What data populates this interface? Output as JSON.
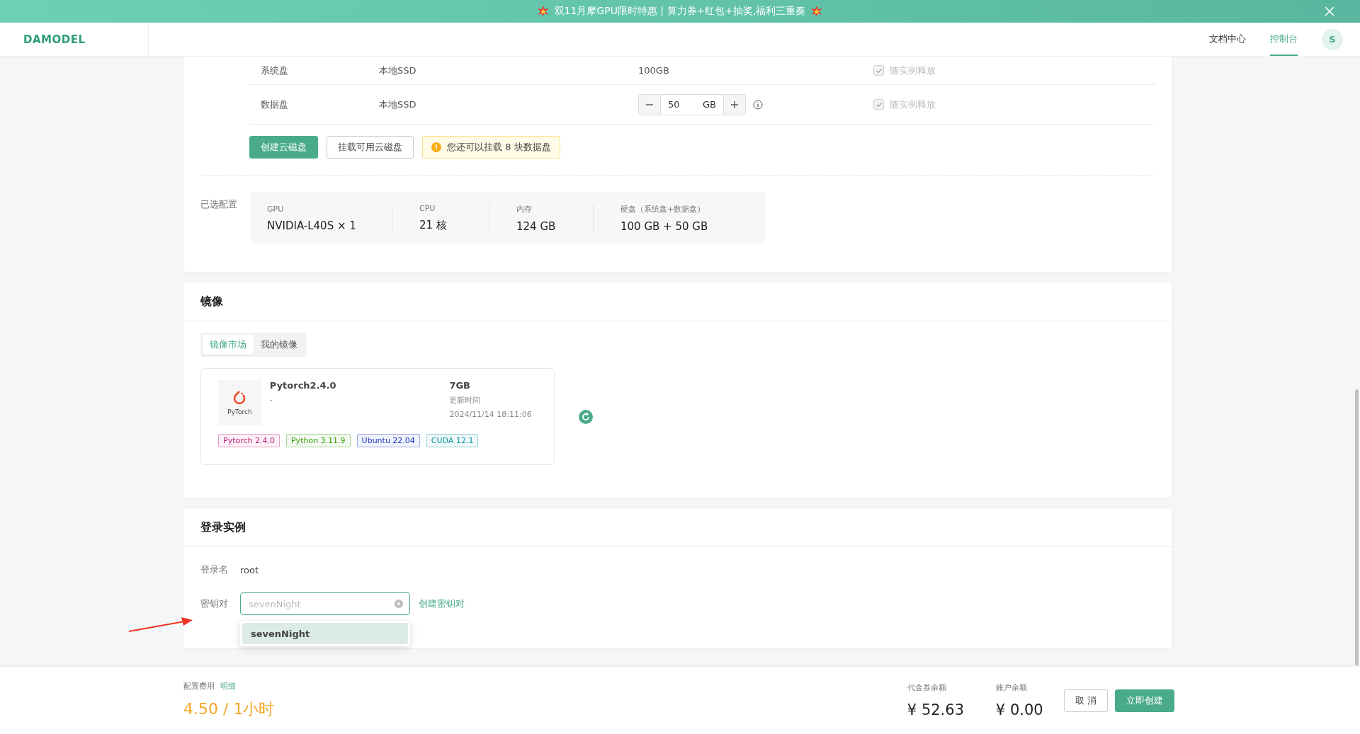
{
  "banner": {
    "text": "双11月摩GPU限时特惠 | 算力券+红包+抽奖,福利三重奏"
  },
  "header": {
    "logo": "DAMODEL",
    "nav": [
      {
        "label": "文档中心",
        "selected": false
      },
      {
        "label": "控制台",
        "selected": true
      }
    ],
    "avatar": "S"
  },
  "disks": {
    "rows": [
      {
        "kind": "fixed",
        "name": "系统盘",
        "type": "本地SSD",
        "size": "100GB",
        "release_label": "随实例释放",
        "checked": true
      },
      {
        "kind": "stepper",
        "name": "数据盘",
        "type": "本地SSD",
        "value": "50",
        "unit": "GB",
        "release_label": "随实例释放",
        "checked": true
      }
    ],
    "buttons": [
      {
        "label": "创建云磁盘",
        "kind": "primary"
      },
      {
        "label": "挂载可用云磁盘",
        "kind": "default"
      }
    ],
    "notice": "您还可以挂载 8 块数据盘"
  },
  "selected_config": {
    "label": "已选配置",
    "items": [
      {
        "label": "GPU",
        "value": "NVIDIA-L40S × 1"
      },
      {
        "label": "CPU",
        "value": "21 核"
      },
      {
        "label": "内存",
        "value": "124 GB"
      },
      {
        "label": "硬盘（系统盘+数据盘）",
        "value": "100 GB + 50 GB"
      }
    ]
  },
  "image": {
    "title": "镜像",
    "tabs": [
      {
        "label": "镜像市场",
        "selected": true
      },
      {
        "label": "我的镜像",
        "selected": false
      }
    ],
    "card": {
      "logo_text": "PyTorch",
      "name": "Pytorch2.4.0",
      "desc": "-",
      "size": "7GB",
      "updated_label": "更新时间",
      "updated": "2024/11/14 18:11:06",
      "tags": [
        {
          "label": "Pytorch 2.4.0",
          "color": "#c41d7f"
        },
        {
          "label": "Python 3.11.9",
          "color": "#389e0d"
        },
        {
          "label": "Ubuntu 22.04",
          "color": "#1d39c4"
        },
        {
          "label": "CUDA 12.1",
          "color": "#08979c"
        }
      ]
    }
  },
  "login": {
    "title": "登录实例",
    "name_label": "登录名",
    "name_value": "root",
    "key_label": "密钥对",
    "key_placeholder": "sevenNight",
    "create_link": "创建密钥对",
    "options": [
      {
        "label": "sevenNight",
        "selected": true
      }
    ]
  },
  "footer": {
    "fee_label": "配置费用",
    "detail_link": "明细",
    "price": "4.50 / 1小时",
    "balances": [
      {
        "label": "代金券余额",
        "value": "¥ 52.63"
      },
      {
        "label": "账户余额",
        "value": "¥ 0.00"
      }
    ],
    "cancel": "取 消",
    "create": "立即创建"
  }
}
